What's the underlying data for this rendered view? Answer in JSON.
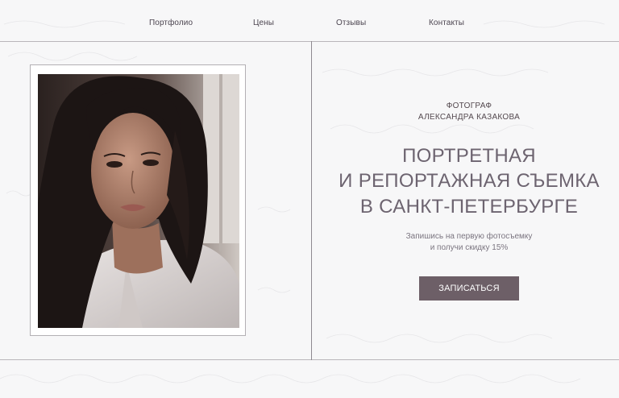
{
  "nav": {
    "items": [
      {
        "label": "Портфолио"
      },
      {
        "label": "Цены"
      },
      {
        "label": "Отзывы"
      },
      {
        "label": "Контакты"
      }
    ]
  },
  "hero": {
    "role": "ФОТОГРАФ",
    "name": "АЛЕКСАНДРА КАЗАКОВА",
    "headline": [
      "ПОРТРЕТНАЯ",
      "И РЕПОРТАЖНАЯ СЪЕМКА",
      "В САНКТ-ПЕТЕРБУРГЕ"
    ],
    "offer": [
      "Запишись на первую фотосъемку",
      "и получи скидку 15%"
    ],
    "cta_label": "ЗАПИСАТЬСЯ",
    "accent_color": "#6d5f67"
  }
}
